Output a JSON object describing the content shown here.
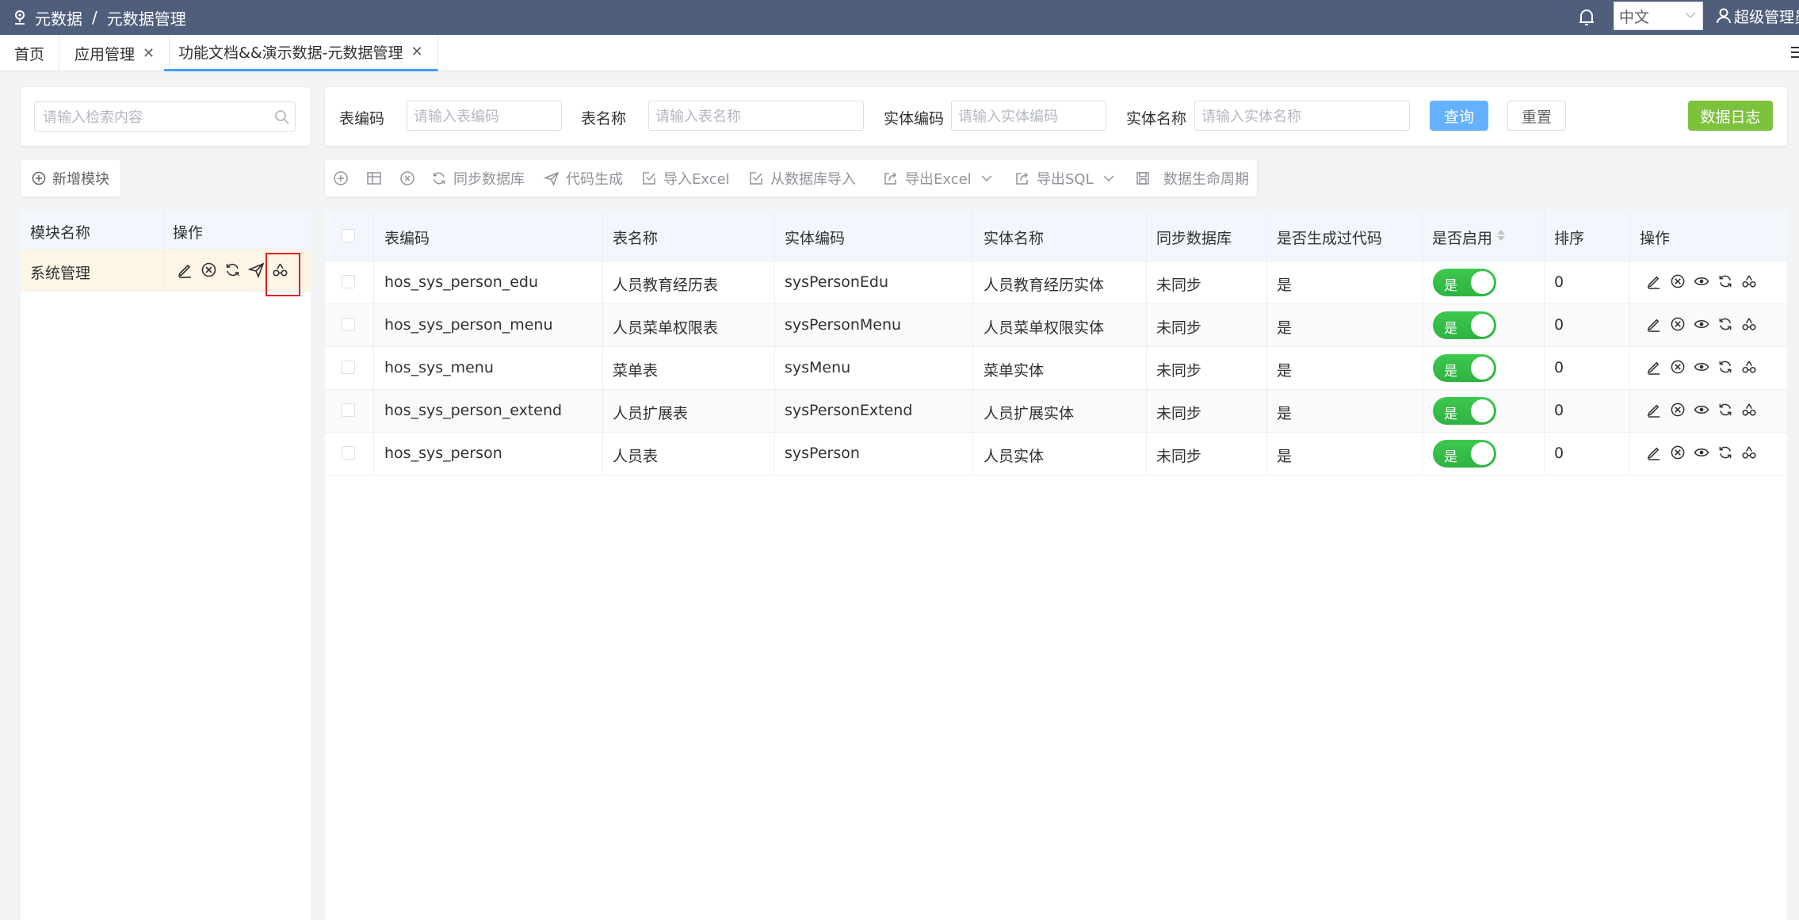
{
  "topbar": {
    "breadcrumb": [
      "元数据",
      "元数据管理"
    ],
    "breadcrumb_sep": "/",
    "language": "中文",
    "user": "超级管理员"
  },
  "tabs": [
    {
      "label": "首页",
      "closable": false
    },
    {
      "label": "应用管理",
      "closable": true
    },
    {
      "label": "功能文档&&演示数据-元数据管理",
      "closable": true,
      "active": true
    }
  ],
  "left": {
    "search_placeholder": "请输入检索内容",
    "add_module": "新增模块",
    "headers": [
      "模块名称",
      "操作"
    ],
    "rows": [
      {
        "name": "系统管理"
      }
    ]
  },
  "filter": {
    "table_code_label": "表编码",
    "table_code_placeholder": "请输入表编码",
    "table_name_label": "表名称",
    "table_name_placeholder": "请输入表名称",
    "entity_code_label": "实体编码",
    "entity_code_placeholder": "请输入实体编码",
    "entity_name_label": "实体名称",
    "entity_name_placeholder": "请输入实体名称",
    "query": "查询",
    "reset": "重置",
    "data_log": "数据日志"
  },
  "toolbar": {
    "sync_db": "同步数据库",
    "code_gen": "代码生成",
    "import_excel": "导入Excel",
    "import_db": "从数据库导入",
    "export_excel": "导出Excel",
    "export_sql": "导出SQL",
    "lifecycle": "数据生命周期"
  },
  "table": {
    "headers": [
      "表编码",
      "表名称",
      "实体编码",
      "实体名称",
      "同步数据库",
      "是否生成过代码",
      "是否启用",
      "排序",
      "操作"
    ],
    "rows": [
      {
        "code": "hos_sys_person_edu",
        "name": "人员教育经历表",
        "entity_code": "sysPersonEdu",
        "entity_name": "人员教育经历实体",
        "sync": "未同步",
        "generated": "是",
        "enabled": "是",
        "sort": "0"
      },
      {
        "code": "hos_sys_person_menu",
        "name": "人员菜单权限表",
        "entity_code": "sysPersonMenu",
        "entity_name": "人员菜单权限实体",
        "sync": "未同步",
        "generated": "是",
        "enabled": "是",
        "sort": "0"
      },
      {
        "code": "hos_sys_menu",
        "name": "菜单表",
        "entity_code": "sysMenu",
        "entity_name": "菜单实体",
        "sync": "未同步",
        "generated": "是",
        "enabled": "是",
        "sort": "0"
      },
      {
        "code": "hos_sys_person_extend",
        "name": "人员扩展表",
        "entity_code": "sysPersonExtend",
        "entity_name": "人员扩展实体",
        "sync": "未同步",
        "generated": "是",
        "enabled": "是",
        "sort": "0"
      },
      {
        "code": "hos_sys_person",
        "name": "人员表",
        "entity_code": "sysPerson",
        "entity_name": "人员实体",
        "sync": "未同步",
        "generated": "是",
        "enabled": "是",
        "sort": "0"
      }
    ]
  },
  "colors": {
    "topbar": "#4f5e7b",
    "primary": "#66b1ff",
    "success": "#3cc84e",
    "log_button": "#7dc23c",
    "highlight": "#e02020"
  }
}
